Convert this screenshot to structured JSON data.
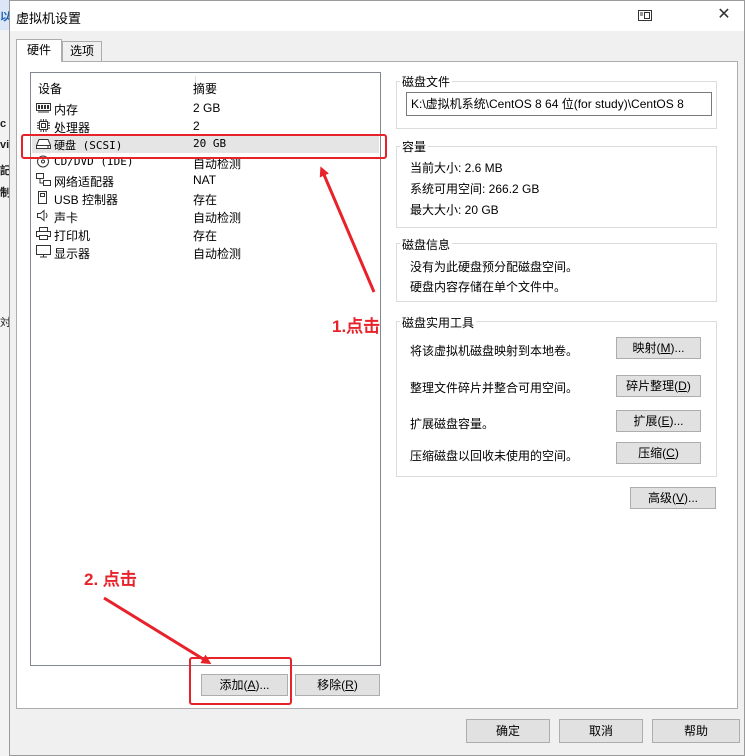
{
  "window": {
    "title": "虚拟机设置"
  },
  "background": {
    "left_fragments": [
      "以",
      "c",
      "vi",
      "記",
      "制",
      "対"
    ]
  },
  "tabs": [
    {
      "label": "硬件",
      "active": true
    },
    {
      "label": "选项",
      "active": false
    }
  ],
  "device_list": {
    "headers": {
      "device": "设备",
      "summary": "摘要"
    },
    "rows": [
      {
        "icon": "memory-icon",
        "name": "内存",
        "summary": "2 GB"
      },
      {
        "icon": "processor-icon",
        "name": "处理器",
        "summary": "2"
      },
      {
        "icon": "hard-disk-icon",
        "name": "硬盘 (SCSI)",
        "summary": "20 GB",
        "selected": true
      },
      {
        "icon": "cd-dvd-icon",
        "name": "CD/DVD (IDE)",
        "summary": "自动检测"
      },
      {
        "icon": "network-adapter-icon",
        "name": "网络适配器",
        "summary": "NAT"
      },
      {
        "icon": "usb-icon",
        "name": "USB 控制器",
        "summary": "存在"
      },
      {
        "icon": "sound-card-icon",
        "name": "声卡",
        "summary": "自动检测"
      },
      {
        "icon": "printer-icon",
        "name": "打印机",
        "summary": "存在"
      },
      {
        "icon": "display-icon",
        "name": "显示器",
        "summary": "自动检测"
      }
    ],
    "add_button": {
      "text": "添加",
      "hotkey": "A",
      "suffix": "..."
    },
    "remove_button": {
      "text": "移除",
      "hotkey": "R",
      "suffix": ""
    }
  },
  "disk_file": {
    "title": "磁盘文件",
    "path": "K:\\虚拟机系统\\CentOS 8 64 位(for study)\\CentOS 8"
  },
  "capacity": {
    "title": "容量",
    "current_size": "当前大小: 2.6 MB",
    "system_free": "系统可用空间: 266.2 GB",
    "max_size": "最大大小: 20 GB"
  },
  "disk_info": {
    "title": "磁盘信息",
    "line1": "没有为此硬盘预分配磁盘空间。",
    "line2": "硬盘内容存储在单个文件中。"
  },
  "disk_utilities": {
    "title": "磁盘实用工具",
    "items": [
      {
        "desc": "将该虚拟机磁盘映射到本地卷。",
        "button": "映射",
        "hotkey": "M",
        "suffix": "..."
      },
      {
        "desc": "整理文件碎片并整合可用空间。",
        "button": "碎片整理",
        "hotkey": "D",
        "suffix": ""
      },
      {
        "desc": "扩展磁盘容量。",
        "button": "扩展",
        "hotkey": "E",
        "suffix": "..."
      },
      {
        "desc": "压缩磁盘以回收未使用的空间。",
        "button": "压缩",
        "hotkey": "C",
        "suffix": ""
      }
    ]
  },
  "advanced_button": {
    "text": "高级",
    "hotkey": "V",
    "suffix": "..."
  },
  "footer": {
    "ok": "确定",
    "cancel": "取消",
    "help": "帮助"
  },
  "annotations": {
    "note1": "1.点击",
    "note2": "2. 点击",
    "color": "#e8222a"
  }
}
